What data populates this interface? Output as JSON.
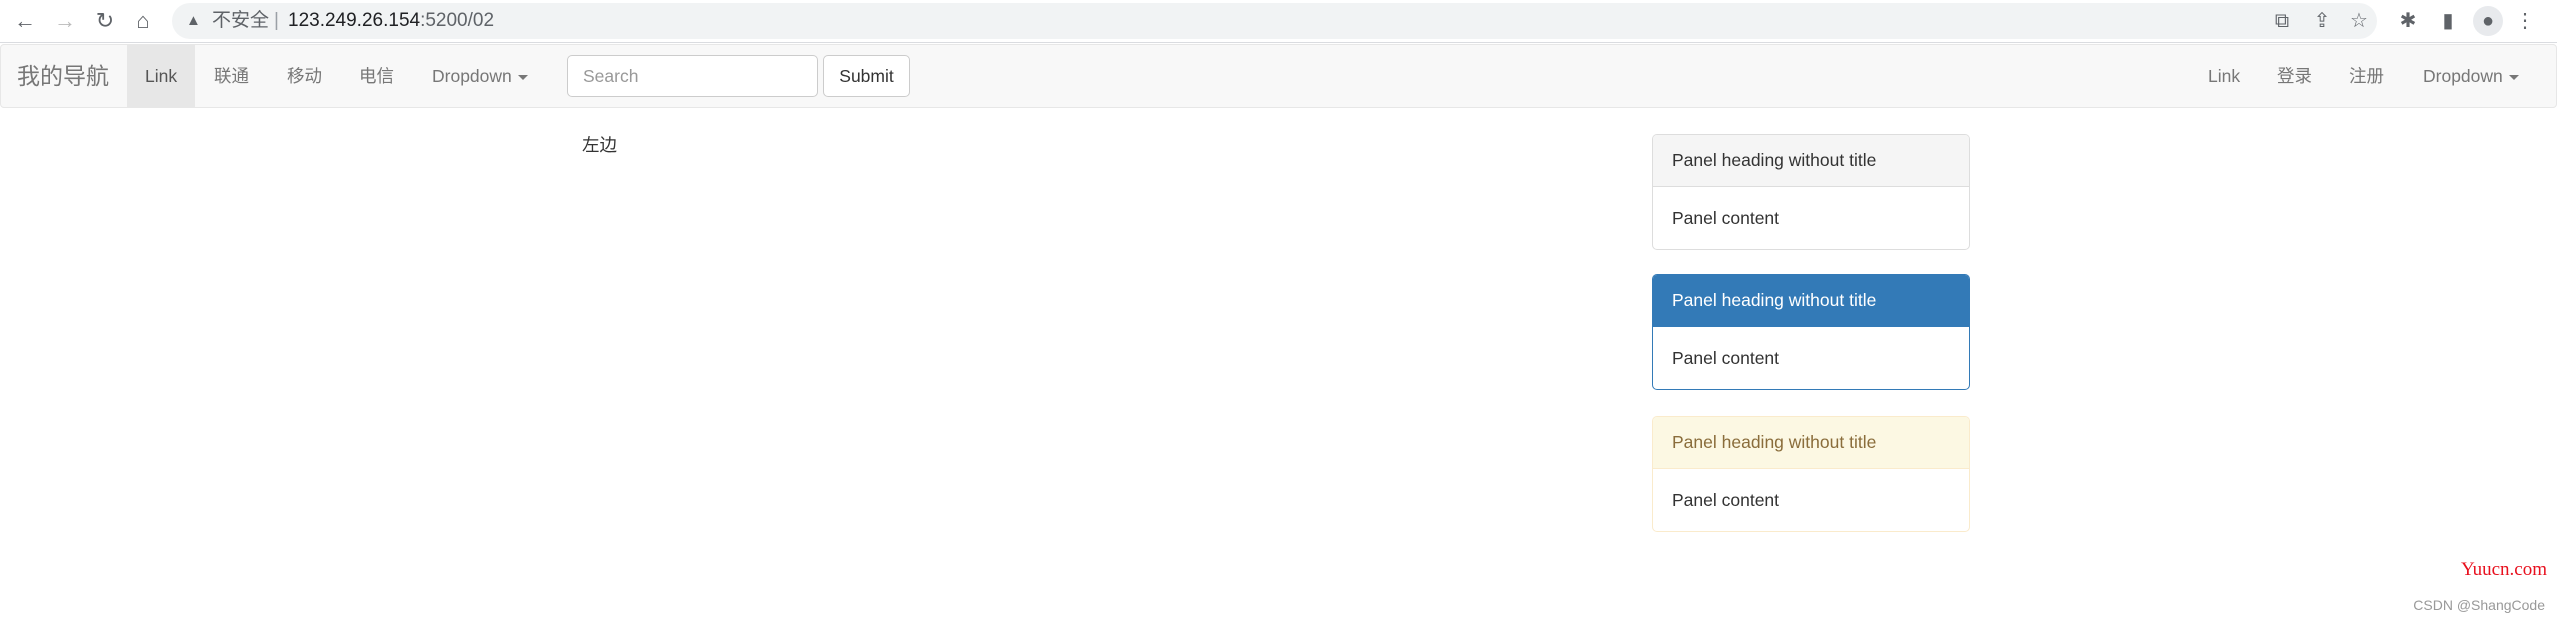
{
  "browser": {
    "security_icon": "warning-triangle-icon",
    "security_label": "不安全",
    "url_host": "123.249.26.154",
    "url_path": ":5200/02"
  },
  "navbar": {
    "brand": "我的导航",
    "left_items": [
      {
        "label": "Link",
        "active": true
      },
      {
        "label": "联通"
      },
      {
        "label": "移动"
      },
      {
        "label": "电信"
      },
      {
        "label": "Dropdown"
      }
    ],
    "search_placeholder": "Search",
    "submit_label": "Submit",
    "right_items": [
      {
        "label": "Link"
      },
      {
        "label": "登录"
      },
      {
        "label": "注册"
      },
      {
        "label": "Dropdown"
      }
    ]
  },
  "main": {
    "left_text": "左边",
    "panels": [
      {
        "heading": "Panel heading without title",
        "content": "Panel content",
        "style": "default"
      },
      {
        "heading": "Panel heading without title",
        "content": "Panel content",
        "style": "primary",
        "color": "#337ab7"
      },
      {
        "heading": "Panel heading without title",
        "content": "Panel content",
        "style": "warning",
        "color": "#fcf8e3"
      }
    ]
  },
  "watermarks": {
    "site": "Yuucn.com",
    "credit": "CSDN @ShangCode"
  }
}
